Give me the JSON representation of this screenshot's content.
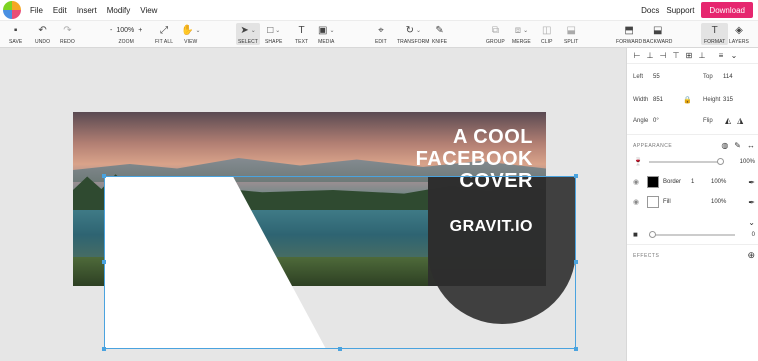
{
  "menu": {
    "items": [
      "File",
      "Edit",
      "Insert",
      "Modify",
      "View"
    ],
    "docs": "Docs",
    "support": "Support",
    "download": "Download"
  },
  "toolbar": {
    "save": "SAVE",
    "undo": "UNDO",
    "redo": "REDO",
    "zoom_minus": "-",
    "zoom_value": "100%",
    "zoom_plus": "+",
    "zoom": "ZOOM",
    "fit_all": "FIT ALL",
    "view": "VIEW",
    "select": "SELECT",
    "shape": "SHAPE",
    "text": "TEXT",
    "media": "MEDIA",
    "edit": "EDIT",
    "transform": "TRANSFORM",
    "knife": "KNIFE",
    "group": "GROUP",
    "merge": "MERGE",
    "clip": "CLIP",
    "split": "SPLIT",
    "forward": "FORWARD",
    "backward": "BACKWARD",
    "format": "FORMAT",
    "layers": "LAYERS"
  },
  "canvas": {
    "cover_title_lines": [
      "A COOL",
      "FACEBOOK",
      "COVER"
    ],
    "cover_subtitle": "GRAVIT.IO"
  },
  "panel": {
    "left_label": "Left",
    "left_value": "55",
    "top_label": "Top",
    "top_value": "114",
    "width_label": "Width",
    "width_value": "851",
    "height_label": "Height",
    "height_value": "315",
    "angle_label": "Angle",
    "angle_value": "0°",
    "flip_label": "Flip",
    "appearance_title": "APPEARANCE",
    "opacity_value": "100%",
    "border_label": "Border",
    "border_width": "1",
    "border_opacity": "100%",
    "border_color": "#000000",
    "fill_label": "Fill",
    "fill_opacity": "100%",
    "fill_color": "#ffffff",
    "blur_value": "0",
    "effects_title": "EFFECTS"
  },
  "colors": {
    "accent": "#e6266f",
    "selection": "#4aa3df"
  }
}
